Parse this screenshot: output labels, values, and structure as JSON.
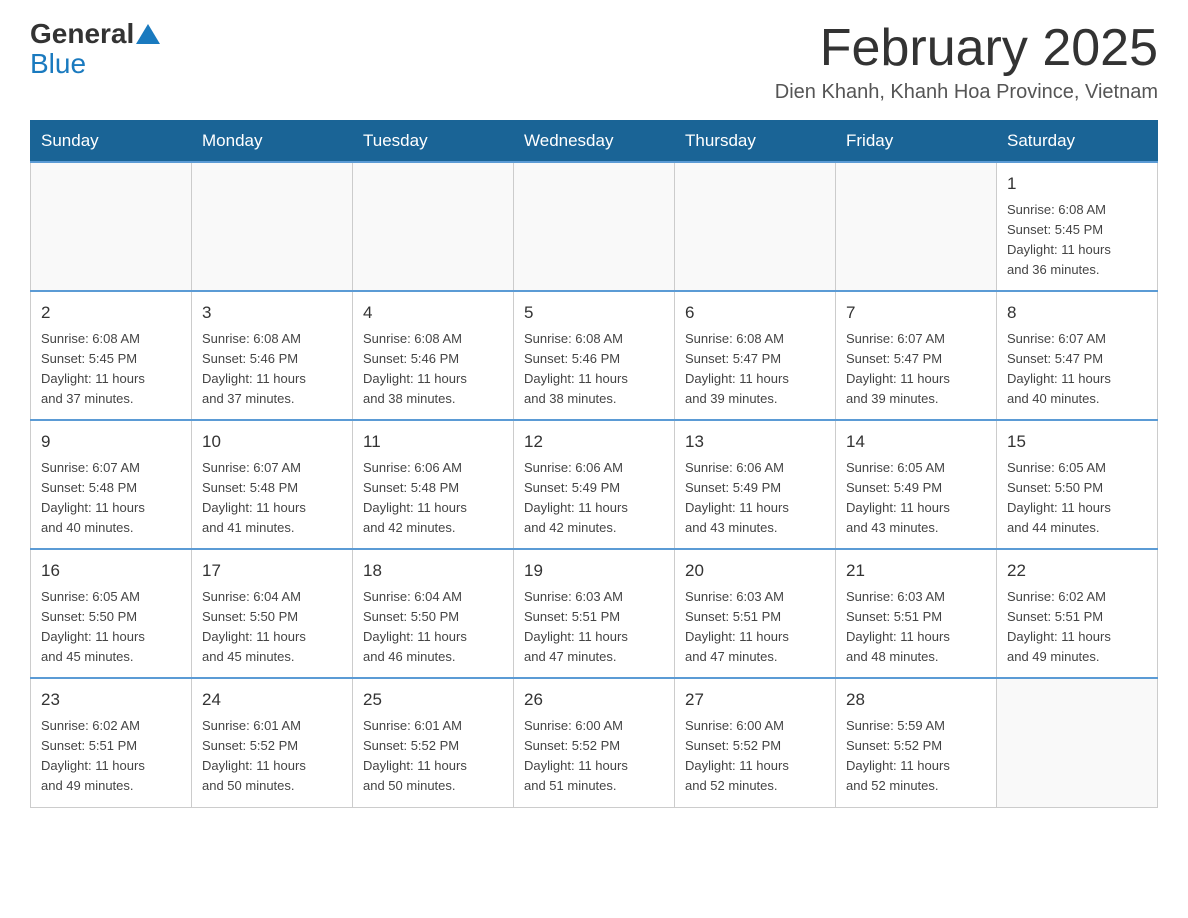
{
  "logo": {
    "part1": "General",
    "part2": "Blue"
  },
  "title": "February 2025",
  "location": "Dien Khanh, Khanh Hoa Province, Vietnam",
  "days_of_week": [
    "Sunday",
    "Monday",
    "Tuesday",
    "Wednesday",
    "Thursday",
    "Friday",
    "Saturday"
  ],
  "weeks": [
    [
      {
        "day": "",
        "info": ""
      },
      {
        "day": "",
        "info": ""
      },
      {
        "day": "",
        "info": ""
      },
      {
        "day": "",
        "info": ""
      },
      {
        "day": "",
        "info": ""
      },
      {
        "day": "",
        "info": ""
      },
      {
        "day": "1",
        "info": "Sunrise: 6:08 AM\nSunset: 5:45 PM\nDaylight: 11 hours\nand 36 minutes."
      }
    ],
    [
      {
        "day": "2",
        "info": "Sunrise: 6:08 AM\nSunset: 5:45 PM\nDaylight: 11 hours\nand 37 minutes."
      },
      {
        "day": "3",
        "info": "Sunrise: 6:08 AM\nSunset: 5:46 PM\nDaylight: 11 hours\nand 37 minutes."
      },
      {
        "day": "4",
        "info": "Sunrise: 6:08 AM\nSunset: 5:46 PM\nDaylight: 11 hours\nand 38 minutes."
      },
      {
        "day": "5",
        "info": "Sunrise: 6:08 AM\nSunset: 5:46 PM\nDaylight: 11 hours\nand 38 minutes."
      },
      {
        "day": "6",
        "info": "Sunrise: 6:08 AM\nSunset: 5:47 PM\nDaylight: 11 hours\nand 39 minutes."
      },
      {
        "day": "7",
        "info": "Sunrise: 6:07 AM\nSunset: 5:47 PM\nDaylight: 11 hours\nand 39 minutes."
      },
      {
        "day": "8",
        "info": "Sunrise: 6:07 AM\nSunset: 5:47 PM\nDaylight: 11 hours\nand 40 minutes."
      }
    ],
    [
      {
        "day": "9",
        "info": "Sunrise: 6:07 AM\nSunset: 5:48 PM\nDaylight: 11 hours\nand 40 minutes."
      },
      {
        "day": "10",
        "info": "Sunrise: 6:07 AM\nSunset: 5:48 PM\nDaylight: 11 hours\nand 41 minutes."
      },
      {
        "day": "11",
        "info": "Sunrise: 6:06 AM\nSunset: 5:48 PM\nDaylight: 11 hours\nand 42 minutes."
      },
      {
        "day": "12",
        "info": "Sunrise: 6:06 AM\nSunset: 5:49 PM\nDaylight: 11 hours\nand 42 minutes."
      },
      {
        "day": "13",
        "info": "Sunrise: 6:06 AM\nSunset: 5:49 PM\nDaylight: 11 hours\nand 43 minutes."
      },
      {
        "day": "14",
        "info": "Sunrise: 6:05 AM\nSunset: 5:49 PM\nDaylight: 11 hours\nand 43 minutes."
      },
      {
        "day": "15",
        "info": "Sunrise: 6:05 AM\nSunset: 5:50 PM\nDaylight: 11 hours\nand 44 minutes."
      }
    ],
    [
      {
        "day": "16",
        "info": "Sunrise: 6:05 AM\nSunset: 5:50 PM\nDaylight: 11 hours\nand 45 minutes."
      },
      {
        "day": "17",
        "info": "Sunrise: 6:04 AM\nSunset: 5:50 PM\nDaylight: 11 hours\nand 45 minutes."
      },
      {
        "day": "18",
        "info": "Sunrise: 6:04 AM\nSunset: 5:50 PM\nDaylight: 11 hours\nand 46 minutes."
      },
      {
        "day": "19",
        "info": "Sunrise: 6:03 AM\nSunset: 5:51 PM\nDaylight: 11 hours\nand 47 minutes."
      },
      {
        "day": "20",
        "info": "Sunrise: 6:03 AM\nSunset: 5:51 PM\nDaylight: 11 hours\nand 47 minutes."
      },
      {
        "day": "21",
        "info": "Sunrise: 6:03 AM\nSunset: 5:51 PM\nDaylight: 11 hours\nand 48 minutes."
      },
      {
        "day": "22",
        "info": "Sunrise: 6:02 AM\nSunset: 5:51 PM\nDaylight: 11 hours\nand 49 minutes."
      }
    ],
    [
      {
        "day": "23",
        "info": "Sunrise: 6:02 AM\nSunset: 5:51 PM\nDaylight: 11 hours\nand 49 minutes."
      },
      {
        "day": "24",
        "info": "Sunrise: 6:01 AM\nSunset: 5:52 PM\nDaylight: 11 hours\nand 50 minutes."
      },
      {
        "day": "25",
        "info": "Sunrise: 6:01 AM\nSunset: 5:52 PM\nDaylight: 11 hours\nand 50 minutes."
      },
      {
        "day": "26",
        "info": "Sunrise: 6:00 AM\nSunset: 5:52 PM\nDaylight: 11 hours\nand 51 minutes."
      },
      {
        "day": "27",
        "info": "Sunrise: 6:00 AM\nSunset: 5:52 PM\nDaylight: 11 hours\nand 52 minutes."
      },
      {
        "day": "28",
        "info": "Sunrise: 5:59 AM\nSunset: 5:52 PM\nDaylight: 11 hours\nand 52 minutes."
      },
      {
        "day": "",
        "info": ""
      }
    ]
  ]
}
